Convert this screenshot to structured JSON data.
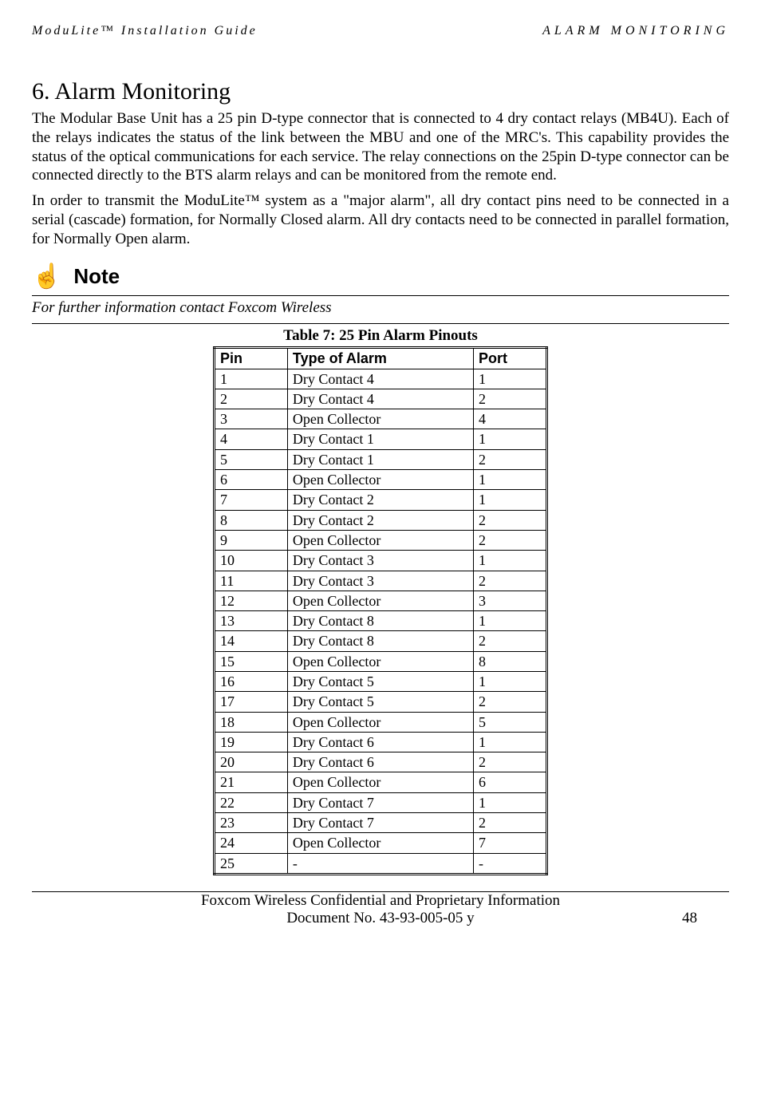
{
  "header": {
    "left": "ModuLite™ Installation Guide",
    "right": "ALARM MONITORING"
  },
  "heading": "6.  Alarm Monitoring",
  "para1": "The Modular Base Unit has a 25 pin D-type connector that is connected to 4 dry contact relays (MB4U). Each of the relays indicates the status of the link between the MBU and one of the MRC's. This capability provides the status of the optical communications for each service. The relay connections on the 25pin D-type connector can be connected directly to the BTS alarm relays and can be monitored from the remote end.",
  "para2": "In order to transmit the ModuLite™ system as a \"major alarm\", all dry contact pins need to be connected in a serial (cascade) formation, for Normally Closed alarm. All dry contacts need to be connected in parallel formation, for Normally Open alarm.",
  "note": {
    "icon": "☝",
    "label": "Note",
    "sub": "For further information contact Foxcom Wireless"
  },
  "table": {
    "caption": "Table 7: 25 Pin Alarm Pinouts",
    "headers": [
      "Pin",
      "Type of Alarm",
      "Port"
    ],
    "rows": [
      [
        "1",
        "Dry Contact 4",
        "1"
      ],
      [
        "2",
        "Dry Contact 4",
        "2"
      ],
      [
        "3",
        "Open Collector",
        "4"
      ],
      [
        "4",
        "Dry Contact 1",
        "1"
      ],
      [
        "5",
        "Dry Contact 1",
        "2"
      ],
      [
        "6",
        "Open Collector",
        "1"
      ],
      [
        "7",
        "Dry Contact 2",
        "1"
      ],
      [
        "8",
        "Dry Contact 2",
        "2"
      ],
      [
        "9",
        "Open Collector",
        "2"
      ],
      [
        "10",
        "Dry Contact 3",
        "1"
      ],
      [
        "11",
        "Dry Contact 3",
        "2"
      ],
      [
        "12",
        "Open Collector",
        "3"
      ],
      [
        "13",
        "Dry Contact 8",
        "1"
      ],
      [
        "14",
        "Dry Contact 8",
        "2"
      ],
      [
        "15",
        "Open Collector",
        "8"
      ],
      [
        "16",
        "Dry Contact 5",
        "1"
      ],
      [
        "17",
        "Dry Contact 5",
        "2"
      ],
      [
        "18",
        "Open Collector",
        "5"
      ],
      [
        "19",
        "Dry Contact 6",
        "1"
      ],
      [
        "20",
        "Dry Contact 6",
        "2"
      ],
      [
        "21",
        "Open Collector",
        "6"
      ],
      [
        "22",
        "Dry Contact 7",
        "1"
      ],
      [
        "23",
        "Dry Contact 7",
        "2"
      ],
      [
        "24",
        "Open Collector",
        "7"
      ],
      [
        "25",
        "-",
        "-"
      ]
    ]
  },
  "footer": {
    "confidential": "Foxcom Wireless Confidential and Proprietary Information",
    "docnum": "Document No. 43-93-005-05 y",
    "page": "48"
  }
}
